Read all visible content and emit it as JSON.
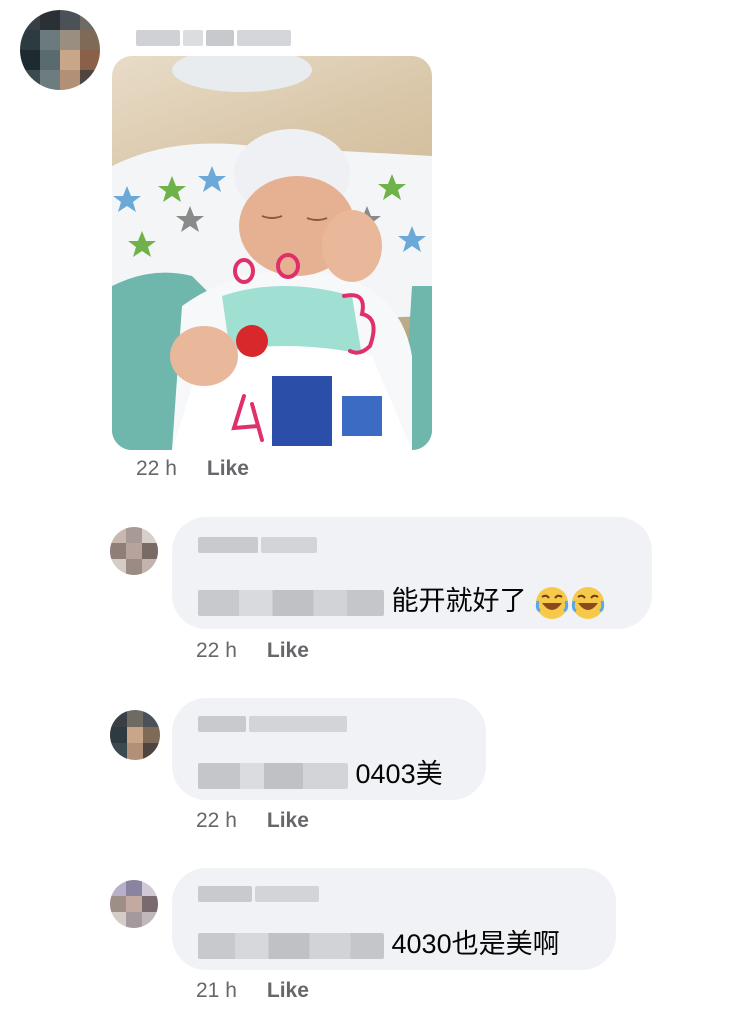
{
  "comments": [
    {
      "time": "22 h",
      "like": "Like"
    },
    {
      "text": "能开就好了",
      "time": "22 h",
      "like": "Like"
    },
    {
      "text": "0403美",
      "time": "22 h",
      "like": "Like"
    },
    {
      "text": "4030也是美啊",
      "time": "21 h",
      "like": "Like"
    }
  ],
  "colors": {
    "bubble": "#f0f2f5",
    "meta": "#65676b",
    "annotation": "#e0306a"
  },
  "icons": [
    "laughing-emoji-icon"
  ]
}
